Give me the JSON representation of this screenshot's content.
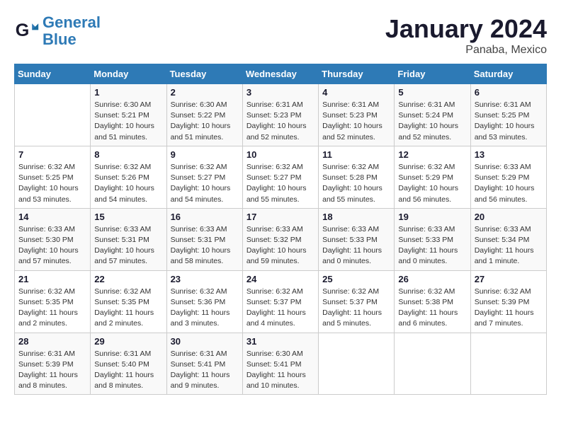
{
  "logo": {
    "line1": "General",
    "line2": "Blue"
  },
  "title": "January 2024",
  "subtitle": "Panaba, Mexico",
  "weekdays": [
    "Sunday",
    "Monday",
    "Tuesday",
    "Wednesday",
    "Thursday",
    "Friday",
    "Saturday"
  ],
  "weeks": [
    [
      {
        "num": "",
        "info": ""
      },
      {
        "num": "1",
        "info": "Sunrise: 6:30 AM\nSunset: 5:21 PM\nDaylight: 10 hours\nand 51 minutes."
      },
      {
        "num": "2",
        "info": "Sunrise: 6:30 AM\nSunset: 5:22 PM\nDaylight: 10 hours\nand 51 minutes."
      },
      {
        "num": "3",
        "info": "Sunrise: 6:31 AM\nSunset: 5:23 PM\nDaylight: 10 hours\nand 52 minutes."
      },
      {
        "num": "4",
        "info": "Sunrise: 6:31 AM\nSunset: 5:23 PM\nDaylight: 10 hours\nand 52 minutes."
      },
      {
        "num": "5",
        "info": "Sunrise: 6:31 AM\nSunset: 5:24 PM\nDaylight: 10 hours\nand 52 minutes."
      },
      {
        "num": "6",
        "info": "Sunrise: 6:31 AM\nSunset: 5:25 PM\nDaylight: 10 hours\nand 53 minutes."
      }
    ],
    [
      {
        "num": "7",
        "info": "Sunrise: 6:32 AM\nSunset: 5:25 PM\nDaylight: 10 hours\nand 53 minutes."
      },
      {
        "num": "8",
        "info": "Sunrise: 6:32 AM\nSunset: 5:26 PM\nDaylight: 10 hours\nand 54 minutes."
      },
      {
        "num": "9",
        "info": "Sunrise: 6:32 AM\nSunset: 5:27 PM\nDaylight: 10 hours\nand 54 minutes."
      },
      {
        "num": "10",
        "info": "Sunrise: 6:32 AM\nSunset: 5:27 PM\nDaylight: 10 hours\nand 55 minutes."
      },
      {
        "num": "11",
        "info": "Sunrise: 6:32 AM\nSunset: 5:28 PM\nDaylight: 10 hours\nand 55 minutes."
      },
      {
        "num": "12",
        "info": "Sunrise: 6:32 AM\nSunset: 5:29 PM\nDaylight: 10 hours\nand 56 minutes."
      },
      {
        "num": "13",
        "info": "Sunrise: 6:33 AM\nSunset: 5:29 PM\nDaylight: 10 hours\nand 56 minutes."
      }
    ],
    [
      {
        "num": "14",
        "info": "Sunrise: 6:33 AM\nSunset: 5:30 PM\nDaylight: 10 hours\nand 57 minutes."
      },
      {
        "num": "15",
        "info": "Sunrise: 6:33 AM\nSunset: 5:31 PM\nDaylight: 10 hours\nand 57 minutes."
      },
      {
        "num": "16",
        "info": "Sunrise: 6:33 AM\nSunset: 5:31 PM\nDaylight: 10 hours\nand 58 minutes."
      },
      {
        "num": "17",
        "info": "Sunrise: 6:33 AM\nSunset: 5:32 PM\nDaylight: 10 hours\nand 59 minutes."
      },
      {
        "num": "18",
        "info": "Sunrise: 6:33 AM\nSunset: 5:33 PM\nDaylight: 11 hours\nand 0 minutes."
      },
      {
        "num": "19",
        "info": "Sunrise: 6:33 AM\nSunset: 5:33 PM\nDaylight: 11 hours\nand 0 minutes."
      },
      {
        "num": "20",
        "info": "Sunrise: 6:33 AM\nSunset: 5:34 PM\nDaylight: 11 hours\nand 1 minute."
      }
    ],
    [
      {
        "num": "21",
        "info": "Sunrise: 6:32 AM\nSunset: 5:35 PM\nDaylight: 11 hours\nand 2 minutes."
      },
      {
        "num": "22",
        "info": "Sunrise: 6:32 AM\nSunset: 5:35 PM\nDaylight: 11 hours\nand 2 minutes."
      },
      {
        "num": "23",
        "info": "Sunrise: 6:32 AM\nSunset: 5:36 PM\nDaylight: 11 hours\nand 3 minutes."
      },
      {
        "num": "24",
        "info": "Sunrise: 6:32 AM\nSunset: 5:37 PM\nDaylight: 11 hours\nand 4 minutes."
      },
      {
        "num": "25",
        "info": "Sunrise: 6:32 AM\nSunset: 5:37 PM\nDaylight: 11 hours\nand 5 minutes."
      },
      {
        "num": "26",
        "info": "Sunrise: 6:32 AM\nSunset: 5:38 PM\nDaylight: 11 hours\nand 6 minutes."
      },
      {
        "num": "27",
        "info": "Sunrise: 6:32 AM\nSunset: 5:39 PM\nDaylight: 11 hours\nand 7 minutes."
      }
    ],
    [
      {
        "num": "28",
        "info": "Sunrise: 6:31 AM\nSunset: 5:39 PM\nDaylight: 11 hours\nand 8 minutes."
      },
      {
        "num": "29",
        "info": "Sunrise: 6:31 AM\nSunset: 5:40 PM\nDaylight: 11 hours\nand 8 minutes."
      },
      {
        "num": "30",
        "info": "Sunrise: 6:31 AM\nSunset: 5:41 PM\nDaylight: 11 hours\nand 9 minutes."
      },
      {
        "num": "31",
        "info": "Sunrise: 6:30 AM\nSunset: 5:41 PM\nDaylight: 11 hours\nand 10 minutes."
      },
      {
        "num": "",
        "info": ""
      },
      {
        "num": "",
        "info": ""
      },
      {
        "num": "",
        "info": ""
      }
    ]
  ]
}
